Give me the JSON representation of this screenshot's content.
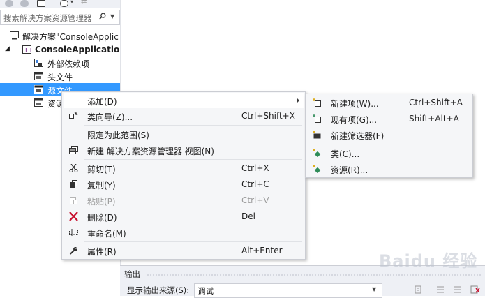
{
  "search": {
    "placeholder": "搜索解决方案资源管理器"
  },
  "tree": [
    {
      "label": "解决方案\"ConsoleApplic",
      "icon": "solution-icon"
    },
    {
      "label": "ConsoleApplication",
      "icon": "project-icon"
    },
    {
      "label": "外部依赖项",
      "icon": "folder-icon"
    },
    {
      "label": "头文件",
      "icon": "folder-icon"
    },
    {
      "label": "源文件",
      "icon": "folder-icon",
      "selected": true
    },
    {
      "label": "资源",
      "icon": "folder-icon"
    }
  ],
  "context_menu": {
    "items": [
      {
        "label": "添加(D)",
        "shortcut": "",
        "icon": "",
        "submenu": true,
        "highlighted": true
      },
      {
        "label": "类向导(Z)...",
        "shortcut": "Ctrl+Shift+X",
        "icon": "class-wizard-icon"
      },
      {
        "label": "限定为此范围(S)",
        "shortcut": "",
        "icon": ""
      },
      {
        "label": "新建 解决方案资源管理器 视图(N)",
        "shortcut": "",
        "icon": "new-view-icon"
      },
      {
        "label": "剪切(T)",
        "shortcut": "Ctrl+X",
        "icon": "cut-icon"
      },
      {
        "label": "复制(Y)",
        "shortcut": "Ctrl+C",
        "icon": "copy-icon"
      },
      {
        "label": "粘贴(P)",
        "shortcut": "Ctrl+V",
        "icon": "paste-icon",
        "disabled": true
      },
      {
        "label": "删除(D)",
        "shortcut": "Del",
        "icon": "delete-icon"
      },
      {
        "label": "重命名(M)",
        "shortcut": "",
        "icon": "rename-icon"
      },
      {
        "label": "属性(R)",
        "shortcut": "Alt+Enter",
        "icon": "properties-icon"
      }
    ]
  },
  "submenu": {
    "items": [
      {
        "label": "新建项(W)...",
        "shortcut": "Ctrl+Shift+A",
        "icon": "new-item-icon"
      },
      {
        "label": "现有项(G)...",
        "shortcut": "Shift+Alt+A",
        "icon": "existing-item-icon"
      },
      {
        "label": "新建筛选器(F)",
        "shortcut": "",
        "icon": "new-filter-icon"
      },
      {
        "label": "类(C)...",
        "shortcut": "",
        "icon": "class-icon"
      },
      {
        "label": "资源(R)...",
        "shortcut": "",
        "icon": "resource-icon"
      }
    ]
  },
  "output": {
    "title": "输出",
    "source_label": "显示输出来源(S):",
    "source_value": "调试"
  },
  "watermark": "Baidu 经验",
  "colors": {
    "selection": "#3399ff",
    "delete_red": "#c8102e",
    "menu_bg": "#f5f6f8"
  }
}
